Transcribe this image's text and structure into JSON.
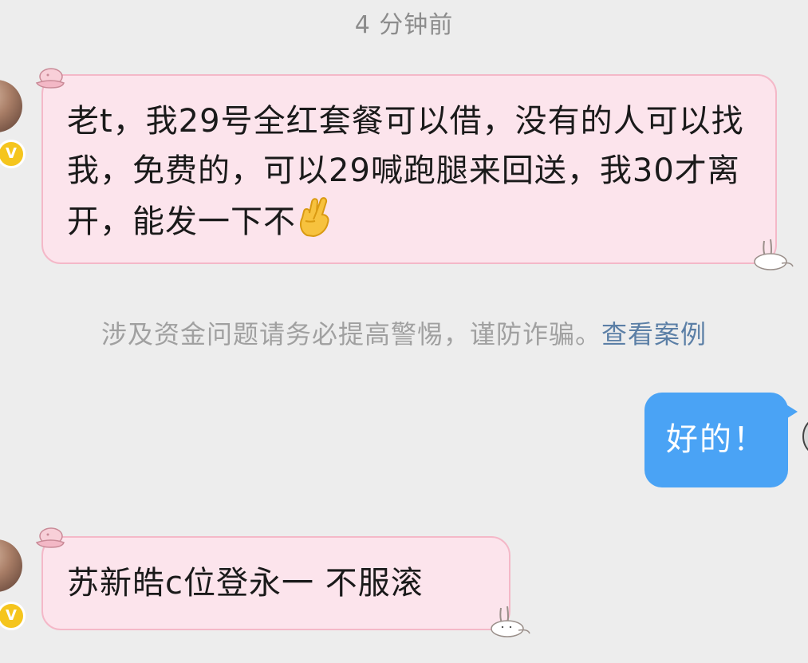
{
  "chat": {
    "timestamp": "4 分钟前",
    "messages": [
      {
        "sender": "other",
        "text": "老t，我29号全红套餐可以借，没有的人可以找我，免费的，可以29喊跑腿来回送，我30才离开，能发一下不",
        "emoji": "crossed-fingers"
      },
      {
        "sender": "self",
        "text": "好的！"
      },
      {
        "sender": "other",
        "text": "苏新皓c位登永一 不服滚"
      }
    ],
    "notice": {
      "text": "涉及资金问题请务必提高警惕，谨防诈骗。",
      "link": "查看案例"
    },
    "badge": "V"
  },
  "colors": {
    "background": "#ededed",
    "incoming_bubble": "#fce4ec",
    "incoming_border": "#f4b8c8",
    "outgoing_bubble": "#4aa3f5",
    "notice_text": "#a0a0a0",
    "notice_link": "#5b7fa6",
    "verified_badge": "#f5c51d"
  },
  "icons": {
    "message_1_emoji": "crossed-fingers-icon",
    "bubble_decor_top": "pink-cap-sticker-icon",
    "bubble_decor_bottom": "bunny-sticker-icon",
    "verified": "verified-badge-icon"
  }
}
